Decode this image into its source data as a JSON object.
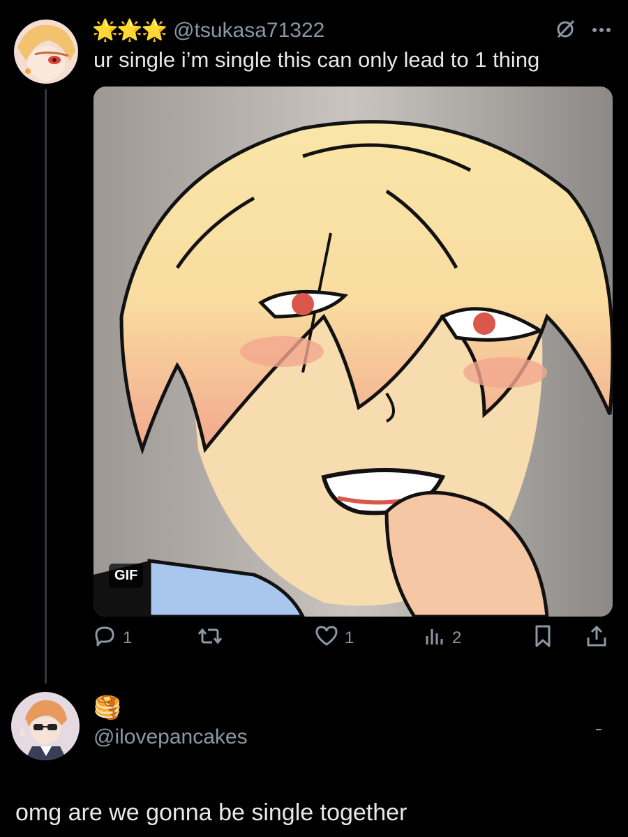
{
  "post1": {
    "badge_emoji": "🌟🌟🌟",
    "handle": "@tsukasa71322",
    "text": "ur single i’m single this can only lead to 1 thing",
    "media_badge": "GIF",
    "actions": {
      "reply_count": "1",
      "like_count": "1",
      "views_count": "2"
    }
  },
  "post2": {
    "badge_emoji": "🥞",
    "handle": "@ilovepancakes",
    "text": "omg are we gonna be single together"
  },
  "colors": {
    "background": "#000000",
    "primary_text": "#e7e9ea",
    "secondary_text": "#8b98a5",
    "thread_line": "#333639"
  },
  "icons": [
    "grok-slash-icon",
    "more-icon",
    "reply-icon",
    "repost-icon",
    "like-icon",
    "views-icon",
    "bookmark-icon",
    "share-icon"
  ]
}
